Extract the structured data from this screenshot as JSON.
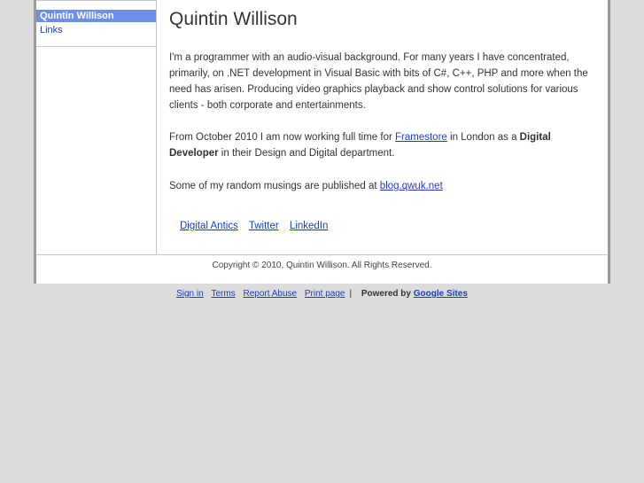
{
  "sidebar": {
    "items": [
      {
        "label": "Quintin Willison",
        "active": true
      },
      {
        "label": "Links",
        "active": false
      }
    ]
  },
  "main": {
    "title": "Quintin Willison",
    "para1": "I'm a programmer with an audio-visual background. For many years I have concentrated, primarily, on .NET development in Visual Basic with bits of C#, C++, PHP and more when the need has arisen. Producing video graphics playback and show control solutions for various clients - both corporate and entertainments.",
    "para2": {
      "before": "From October 2010 I am now working full time for ",
      "link": "Framestore",
      "middle": " in London as a ",
      "bold": "Digital Developer",
      "after": " in their Design and Digital department."
    },
    "para3": {
      "before": "Some of my random musings are published at ",
      "link": "blog.qwuk.net"
    },
    "links": [
      "Digital Antics",
      "Twitter",
      "LinkedIn"
    ]
  },
  "copyright": "Copyright © 2010, Quintin Willison. All Rights Reserved.",
  "site_footer": {
    "links": [
      "Sign in",
      "Terms",
      "Report Abuse",
      "Print page"
    ],
    "separator": "|",
    "powered_by": "Powered by",
    "google_sites": "Google Sites"
  }
}
